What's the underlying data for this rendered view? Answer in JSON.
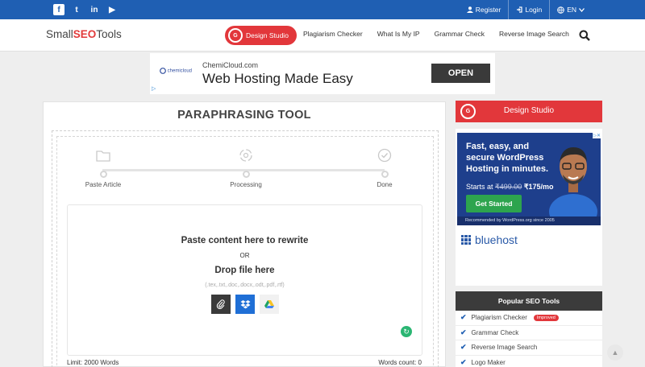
{
  "topbar": {
    "social": [
      {
        "icon": "facebook-icon",
        "glyph": "f"
      },
      {
        "icon": "twitter-icon",
        "glyph": "t"
      },
      {
        "icon": "linkedin-icon",
        "glyph": "in"
      },
      {
        "icon": "youtube-icon",
        "glyph": "▶"
      }
    ],
    "register": "Register",
    "login": "Login",
    "language": "EN"
  },
  "nav": {
    "logo": {
      "pre": "Small",
      "mid": "SEO",
      "post": "Tools"
    },
    "design_studio": "Design Studio",
    "links": [
      "Plagiarism Checker",
      "What Is My IP",
      "Grammar Check",
      "Reverse Image Search"
    ]
  },
  "ad_top": {
    "brand": "chemicloud",
    "sub": "ChemiCloud.com",
    "headline": "Web Hosting Made Easy",
    "cta": "OPEN"
  },
  "main": {
    "title": "PARAPHRASING TOOL",
    "steps": [
      "Paste Article",
      "Processing",
      "Done"
    ],
    "drop": {
      "line1": "Paste content here to rewrite",
      "or": "OR",
      "line2": "Drop file here",
      "formats": "(.tex,.txt,.doc,.docx,.odt,.pdf,.rtf)"
    },
    "limit": "Limit: 2000 Words",
    "words_count": "Words count: 0"
  },
  "sidebar": {
    "design_studio": "Design Studio",
    "ad": {
      "text": "Fast, easy, and secure WordPress Hosting in minutes.",
      "starts_at": "Starts at",
      "old_price": "₹499.00",
      "new_price": "₹175/mo",
      "cta": "Get Started",
      "recommended": "Recommended by WordPress.org since 2005",
      "brand": "bluehost"
    },
    "popular": {
      "title": "Popular SEO Tools",
      "items": [
        {
          "label": "Plagiarism Checker",
          "badge": "Improved"
        },
        {
          "label": "Grammar Check",
          "badge": ""
        },
        {
          "label": "Reverse Image Search",
          "badge": ""
        },
        {
          "label": "Logo Maker",
          "badge": ""
        }
      ]
    }
  },
  "colors": {
    "brand_blue": "#1f5fb3",
    "brand_red": "#e2373b",
    "dark": "#3b3b3b"
  }
}
